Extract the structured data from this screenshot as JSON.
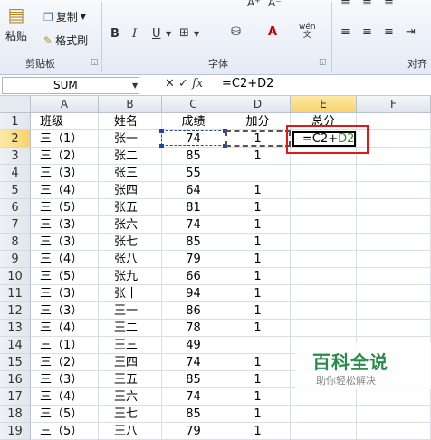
{
  "ribbon": {
    "paste_label": "粘贴",
    "copy_label": "复制",
    "format_painter_label": "格式刷",
    "clipboard_label": "剪贴板",
    "font_label": "字体",
    "align_label": "对齐",
    "wen_label": "wén"
  },
  "formula_bar": {
    "name_box": "SUM",
    "formula": "=C2+D2"
  },
  "columns": [
    "A",
    "B",
    "C",
    "D",
    "E",
    "F"
  ],
  "rows": [
    {
      "n": "1",
      "a": "班级",
      "b": "姓名",
      "c": "成绩",
      "d": "加分",
      "e": "总分"
    },
    {
      "n": "2",
      "a": "三（1）",
      "b": "张一",
      "c": "74",
      "d": "1",
      "e": "=C2+D2"
    },
    {
      "n": "3",
      "a": "三（2）",
      "b": "张二",
      "c": "85",
      "d": "1",
      "e": ""
    },
    {
      "n": "4",
      "a": "三（3）",
      "b": "张三",
      "c": "55",
      "d": "",
      "e": ""
    },
    {
      "n": "5",
      "a": "三（4）",
      "b": "张四",
      "c": "64",
      "d": "1",
      "e": ""
    },
    {
      "n": "6",
      "a": "三（5）",
      "b": "张五",
      "c": "81",
      "d": "1",
      "e": ""
    },
    {
      "n": "7",
      "a": "三（3）",
      "b": "张六",
      "c": "74",
      "d": "1",
      "e": ""
    },
    {
      "n": "8",
      "a": "三（3）",
      "b": "张七",
      "c": "85",
      "d": "1",
      "e": ""
    },
    {
      "n": "9",
      "a": "三（4）",
      "b": "张八",
      "c": "79",
      "d": "1",
      "e": ""
    },
    {
      "n": "10",
      "a": "三（5）",
      "b": "张九",
      "c": "66",
      "d": "1",
      "e": ""
    },
    {
      "n": "11",
      "a": "三（3）",
      "b": "张十",
      "c": "94",
      "d": "1",
      "e": ""
    },
    {
      "n": "12",
      "a": "三（3）",
      "b": "王一",
      "c": "86",
      "d": "1",
      "e": ""
    },
    {
      "n": "13",
      "a": "三（4）",
      "b": "王二",
      "c": "78",
      "d": "1",
      "e": ""
    },
    {
      "n": "14",
      "a": "三（1）",
      "b": "王三",
      "c": "49",
      "d": "",
      "e": ""
    },
    {
      "n": "15",
      "a": "三（2）",
      "b": "王四",
      "c": "74",
      "d": "1",
      "e": ""
    },
    {
      "n": "16",
      "a": "三（3）",
      "b": "王五",
      "c": "85",
      "d": "1",
      "e": ""
    },
    {
      "n": "17",
      "a": "三（4）",
      "b": "王六",
      "c": "74",
      "d": "1",
      "e": ""
    },
    {
      "n": "18",
      "a": "三（5）",
      "b": "王七",
      "c": "85",
      "d": "1",
      "e": ""
    },
    {
      "n": "19",
      "a": "三（5）",
      "b": "王八",
      "c": "79",
      "d": "1",
      "e": ""
    }
  ],
  "edit_formula_prefix": "=C2+",
  "edit_formula_ref": "D2",
  "watermark": {
    "title": "百科全说",
    "subtitle": "助你轻松解决"
  },
  "colors": {
    "ref_c2": "#1f3fbf",
    "ref_d2": "#2a8a2a",
    "highlight": "#e01818"
  }
}
